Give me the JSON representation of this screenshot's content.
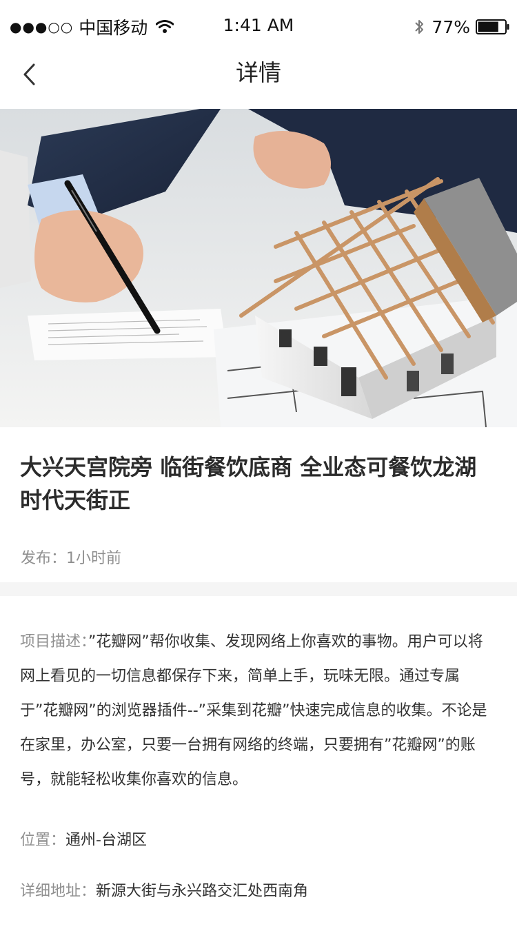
{
  "status_bar": {
    "signal": "●●●○○",
    "carrier": "中国移动",
    "time": "1:41 AM",
    "battery_percent": "77%",
    "battery_level": 0.77,
    "icons": [
      "signal-dots-icon",
      "wifi-icon",
      "bluetooth-icon",
      "battery-icon"
    ]
  },
  "nav": {
    "title": "详情",
    "back_icon": "chevron-left-icon"
  },
  "listing": {
    "title": "大兴天宫院旁 临街餐饮底商 全业态可餐饮龙湖时代天街正",
    "publish_label": "发布：",
    "publish_value": "1小时前"
  },
  "details": {
    "description_label": "项目描述：",
    "description_text": "”花瓣网”帮你收集、发现网络上你喜欢的事物。用户可以将网上看见的一切信息都保存下来，简单上手，玩味无限。通过专属于”花瓣网”的浏览器插件--”采集到花瓣”快速完成信息的收集。不论是在家里，办公室，只要一台拥有网络的终端，只要拥有”花瓣网”的账号，就能轻松收集你喜欢的信息。",
    "location_label": "位置：",
    "location_value": "通州-台湖区",
    "address_label": "详细地址：",
    "address_value": "新源大街与永兴路交汇处西南角"
  }
}
